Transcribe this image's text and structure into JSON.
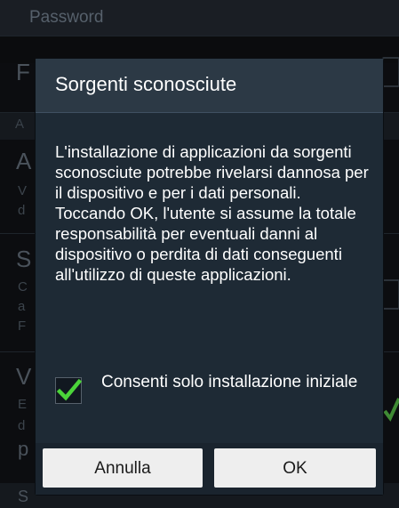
{
  "background": {
    "header_label": "Password",
    "row_letters": [
      "F",
      "A",
      "A",
      "S",
      "V",
      "p",
      "S"
    ],
    "row_small_letters": [
      "V",
      "d",
      "C",
      "a",
      "F",
      "E",
      "d"
    ]
  },
  "dialog": {
    "title": "Sorgenti sconosciute",
    "message": "L'installazione di applicazioni da sorgenti sconosciute potrebbe rivelarsi dannosa per il dispositivo e per i dati personali. Toccando OK, l'utente si assume la totale responsabilità per eventuali danni al dispositivo o perdita di dati conseguenti all'utilizzo di queste applicazioni.",
    "checkbox": {
      "label": "Consenti solo installazione iniziale",
      "checked": true
    },
    "buttons": {
      "cancel": "Annulla",
      "ok": "OK"
    }
  },
  "colors": {
    "dialog_bg": "#1e2a35",
    "header_bg": "#2c3945",
    "check_green": "#4bd43a",
    "button_bg": "#eeeeee"
  }
}
